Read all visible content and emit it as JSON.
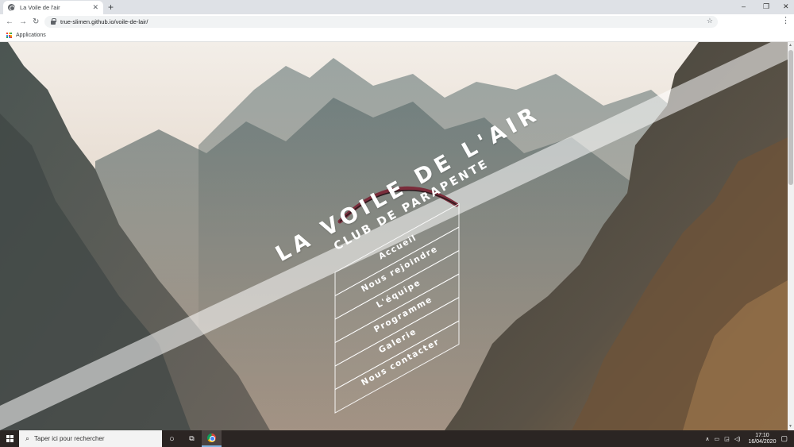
{
  "browser": {
    "tab_title": "La Voile de l'air",
    "tab_close": "✕",
    "new_tab": "+",
    "url": "true-slimen.github.io/voile-de-lair/",
    "bookmarks_label": "Applications",
    "window_controls": {
      "minimize": "–",
      "maximize": "❐",
      "close": "✕"
    },
    "nav": {
      "back": "←",
      "forward": "→",
      "reload": "↻"
    },
    "star": "☆",
    "menu": "⋮"
  },
  "site": {
    "title": "LA VOILE DE L'AIR",
    "subtitle": "CLUB DE PARAPENTE",
    "menu": [
      {
        "label": "Accueil"
      },
      {
        "label": "Nous rejoindre"
      },
      {
        "label": "L'équipe"
      },
      {
        "label": "Programme"
      },
      {
        "label": "Galerie"
      },
      {
        "label": "Nous contacter"
      }
    ]
  },
  "taskbar": {
    "search_placeholder": "Taper ici pour rechercher",
    "time": "17:10",
    "date": "16/04/2020",
    "tray_icons": [
      "chevron-up-icon",
      "battery-icon",
      "network-icon",
      "volume-icon"
    ],
    "apps": [
      "cortana-icon",
      "task-view-icon",
      "chrome-icon"
    ]
  },
  "colors": {
    "tabstrip": "#dee1e6",
    "taskbar": "#2b2523",
    "band": "#ffffff",
    "apps_grid": [
      "#ea4335",
      "#fbbc04",
      "#34a853",
      "#4285f4",
      "#ea4335",
      "#fbbc04",
      "#34a853",
      "#4285f4",
      "#ea4335"
    ]
  }
}
